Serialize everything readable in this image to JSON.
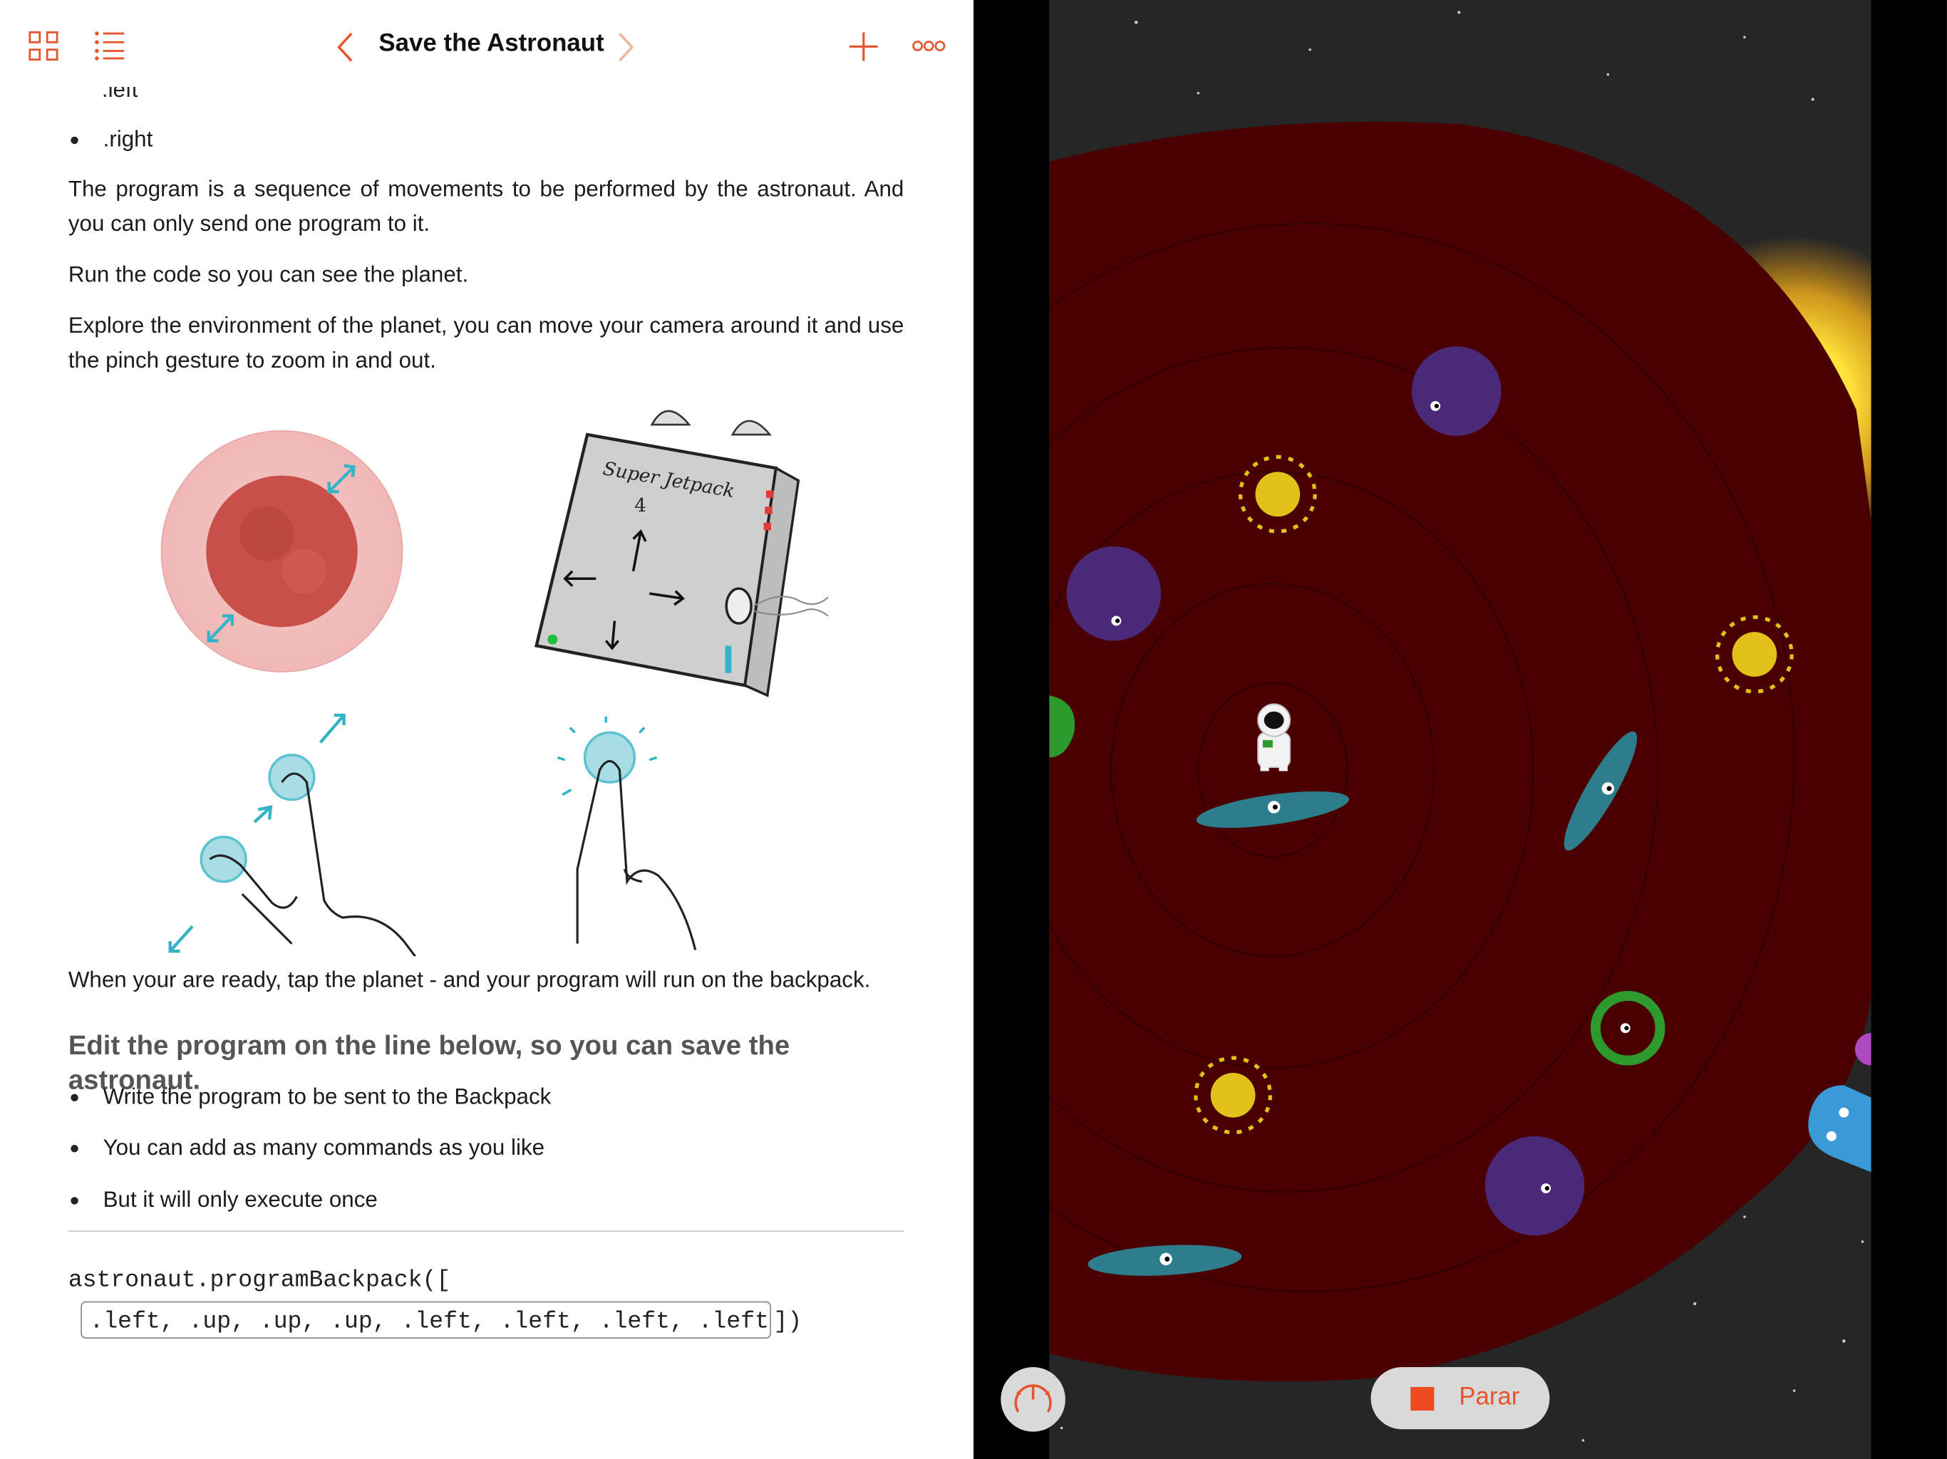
{
  "nav": {
    "title": "Save the Astronaut",
    "peek_text": ".left"
  },
  "doc": {
    "bullets_top": [
      ".right"
    ],
    "p1": "The program is a sequence of movements to be performed by the astronaut. And you can only send one program to it.",
    "p2": "Run the code so you can see the planet.",
    "p3": "Explore the environment of the planet, you can move your camera around it and use the pinch gesture to zoom in and out.",
    "illustration": {
      "jetpack_label": "Super Jetpack",
      "jetpack_number": "4"
    },
    "p4": "When your are ready, tap the planet - and your program will run on the backpack.",
    "heading": "Edit the program on the line below, so you can save the astronaut.",
    "bullets": [
      "Write the program to be sent to the Backpack",
      "You can add as many commands as you like",
      "But it will only execute once"
    ],
    "code_line1": "astronaut.programBackpack([",
    "code_input_value": ".left, .up, .up, .up, .left, .left, .left, .left",
    "code_close": "])"
  },
  "live": {
    "stop_label": "Parar",
    "planet_color": "#4a0000",
    "accent_color": "#e8532c"
  },
  "icons": {
    "grid": "grid-icon",
    "list": "list-icon",
    "back": "chevron-left-icon",
    "forward": "chevron-right-icon",
    "add": "plus-icon",
    "more": "more-icon",
    "gauge": "speedometer-icon",
    "stop": "stop-icon"
  }
}
